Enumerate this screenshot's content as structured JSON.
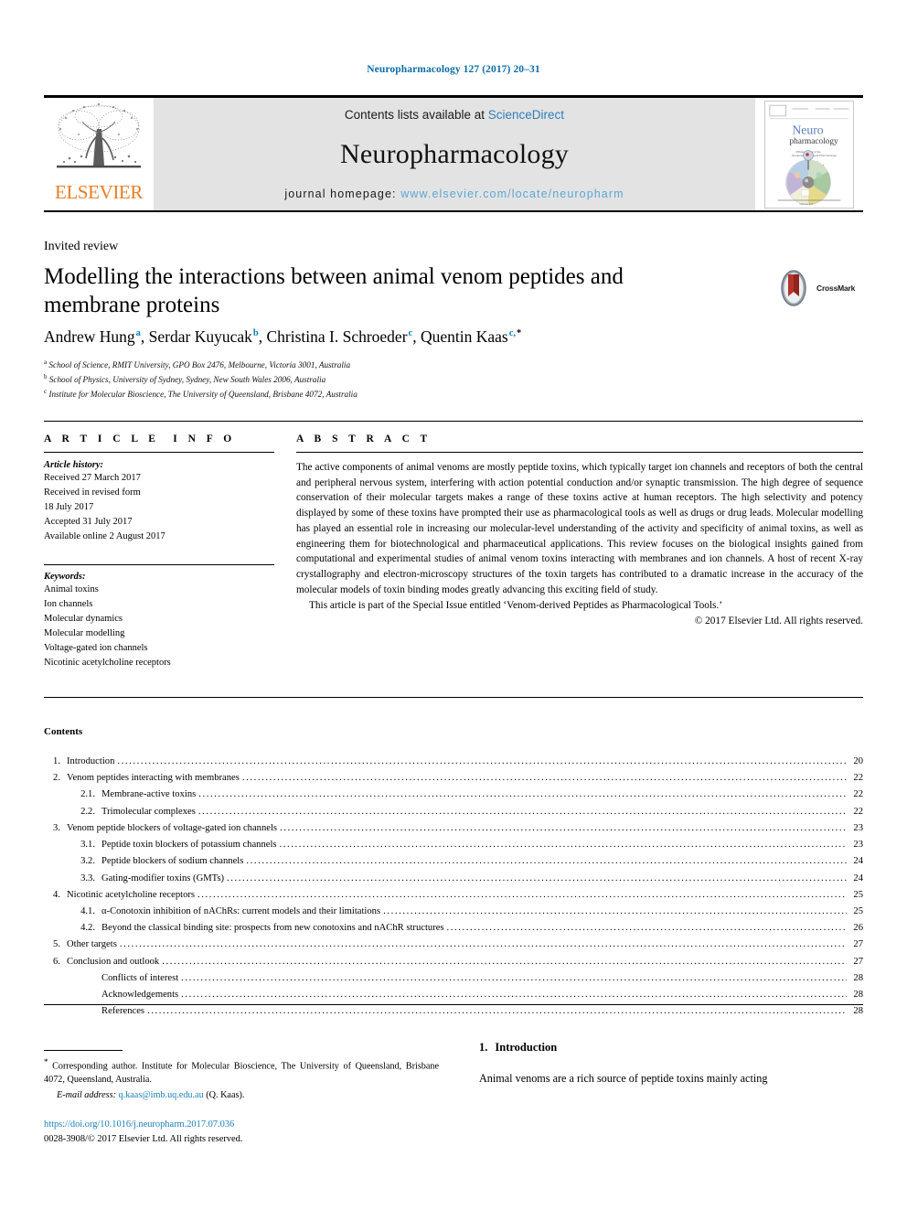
{
  "citation": "Neuropharmacology 127 (2017) 20–31",
  "masthead": {
    "publisher_name": "ELSEVIER",
    "contents_prefix": "Contents lists available at",
    "contents_link": "ScienceDirect",
    "journal_name": "Neuropharmacology",
    "homepage_prefix": "journal homepage:",
    "homepage_url": "www.elsevier.com/locate/neuropharm",
    "cover_title_line1": "Neuro",
    "cover_title_line2": "pharmacology",
    "cover_sub1": "Official Journal of the\nEuropean Behavioural Pharmacology Society",
    "cover_sub2": "Editor-in-Chief\nM. Zoli",
    "cover_volume": "Volume 127"
  },
  "article": {
    "type": "Invited review",
    "title": "Modelling the interactions between animal venom peptides and membrane proteins",
    "crossmark_label": "CrossMark",
    "authors": [
      {
        "name": "Andrew Hung",
        "marks": [
          "a"
        ]
      },
      {
        "name": "Serdar Kuyucak",
        "marks": [
          "b"
        ]
      },
      {
        "name": "Christina I. Schroeder",
        "marks": [
          "c"
        ]
      },
      {
        "name": "Quentin Kaas",
        "marks": [
          "c",
          "*"
        ]
      }
    ],
    "affiliations": [
      {
        "mark": "a",
        "text": "School of Science, RMIT University, GPO Box 2476, Melbourne, Victoria 3001, Australia"
      },
      {
        "mark": "b",
        "text": "School of Physics, University of Sydney, Sydney, New South Wales 2006, Australia"
      },
      {
        "mark": "c",
        "text": "Institute for Molecular Bioscience, The University of Queensland, Brisbane 4072, Australia"
      }
    ]
  },
  "article_info": {
    "heading": "ARTICLE INFO",
    "history_label": "Article history:",
    "history": [
      "Received 27 March 2017",
      "Received in revised form",
      "18 July 2017",
      "Accepted 31 July 2017",
      "Available online 2 August 2017"
    ],
    "keywords_label": "Keywords:",
    "keywords": [
      "Animal toxins",
      "Ion channels",
      "Molecular dynamics",
      "Molecular modelling",
      "Voltage-gated ion channels",
      "Nicotinic acetylcholine receptors"
    ]
  },
  "abstract": {
    "heading": "ABSTRACT",
    "body": "The active components of animal venoms are mostly peptide toxins, which typically target ion channels and receptors of both the central and peripheral nervous system, interfering with action potential conduction and/or synaptic transmission. The high degree of sequence conservation of their molecular targets makes a range of these toxins active at human receptors. The high selectivity and potency displayed by some of these toxins have prompted their use as pharmacological tools as well as drugs or drug leads. Molecular modelling has played an essential role in increasing our molecular-level understanding of the activity and specificity of animal toxins, as well as engineering them for biotechnological and pharmaceutical applications. This review focuses on the biological insights gained from computational and experimental studies of animal venom toxins interacting with membranes and ion channels. A host of recent X-ray crystallography and electron-microscopy structures of the toxin targets has contributed to a dramatic increase in the accuracy of the molecular models of toxin binding modes greatly advancing this exciting field of study.",
    "special_issue": "This article is part of the Special Issue entitled ‘Venom-derived Peptides as Pharmacological Tools.’",
    "copyright": "© 2017 Elsevier Ltd. All rights reserved."
  },
  "contents": {
    "heading": "Contents",
    "entries": [
      {
        "level": 1,
        "num": "1.",
        "label": "Introduction",
        "page": "20"
      },
      {
        "level": 1,
        "num": "2.",
        "label": "Venom peptides interacting with membranes",
        "page": "22"
      },
      {
        "level": 2,
        "num": "2.1.",
        "label": "Membrane-active toxins",
        "page": "22"
      },
      {
        "level": 2,
        "num": "2.2.",
        "label": "Trimolecular complexes",
        "page": "22"
      },
      {
        "level": 1,
        "num": "3.",
        "label": "Venom peptide blockers of voltage-gated ion channels",
        "page": "23"
      },
      {
        "level": 2,
        "num": "3.1.",
        "label": "Peptide toxin blockers of potassium channels",
        "page": "23"
      },
      {
        "level": 2,
        "num": "3.2.",
        "label": "Peptide blockers of sodium channels",
        "page": "24"
      },
      {
        "level": 2,
        "num": "3.3.",
        "label": "Gating-modifier toxins (GMTs)",
        "page": "24"
      },
      {
        "level": 1,
        "num": "4.",
        "label": "Nicotinic acetylcholine receptors",
        "page": "25"
      },
      {
        "level": 2,
        "num": "4.1.",
        "label": "α-Conotoxin inhibition of nAChRs: current models and their limitations",
        "page": "25"
      },
      {
        "level": 2,
        "num": "4.2.",
        "label": "Beyond the classical binding site: prospects from new conotoxins and nAChR structures",
        "page": "26"
      },
      {
        "level": 1,
        "num": "5.",
        "label": "Other targets",
        "page": "27"
      },
      {
        "level": 1,
        "num": "6.",
        "label": "Conclusion and outlook",
        "page": "27"
      },
      {
        "level": 0,
        "num": "",
        "label": "Conflicts of interest",
        "page": "28"
      },
      {
        "level": 0,
        "num": "",
        "label": "Acknowledgements",
        "page": "28"
      },
      {
        "level": 0,
        "num": "",
        "label": "References",
        "page": "28"
      }
    ]
  },
  "footer": {
    "corresponding": "Corresponding author. Institute for Molecular Bioscience, The University of Queensland, Brisbane 4072, Queensland, Australia.",
    "email_label": "E-mail address:",
    "email_address": "q.kaas@imb.uq.edu.au",
    "email_owner": "(Q. Kaas).",
    "doi": "https://doi.org/10.1016/j.neuropharm.2017.07.036",
    "issn_line": "0028-3908/© 2017 Elsevier Ltd. All rights reserved."
  },
  "intro": {
    "number": "1.",
    "heading": "Introduction",
    "paragraph": "Animal venoms are a rich source of peptide toxins mainly acting"
  },
  "colors": {
    "link_blue": "#1a7fba",
    "citation_blue": "#0b6ea8",
    "sciencedirect_blue": "#2e7fb8",
    "homepage_blue": "#5aa7d6",
    "elsevier_orange": "#ea7d24",
    "banner_grey": "#e3e3e3",
    "crossmark_red": "#b5332a"
  }
}
